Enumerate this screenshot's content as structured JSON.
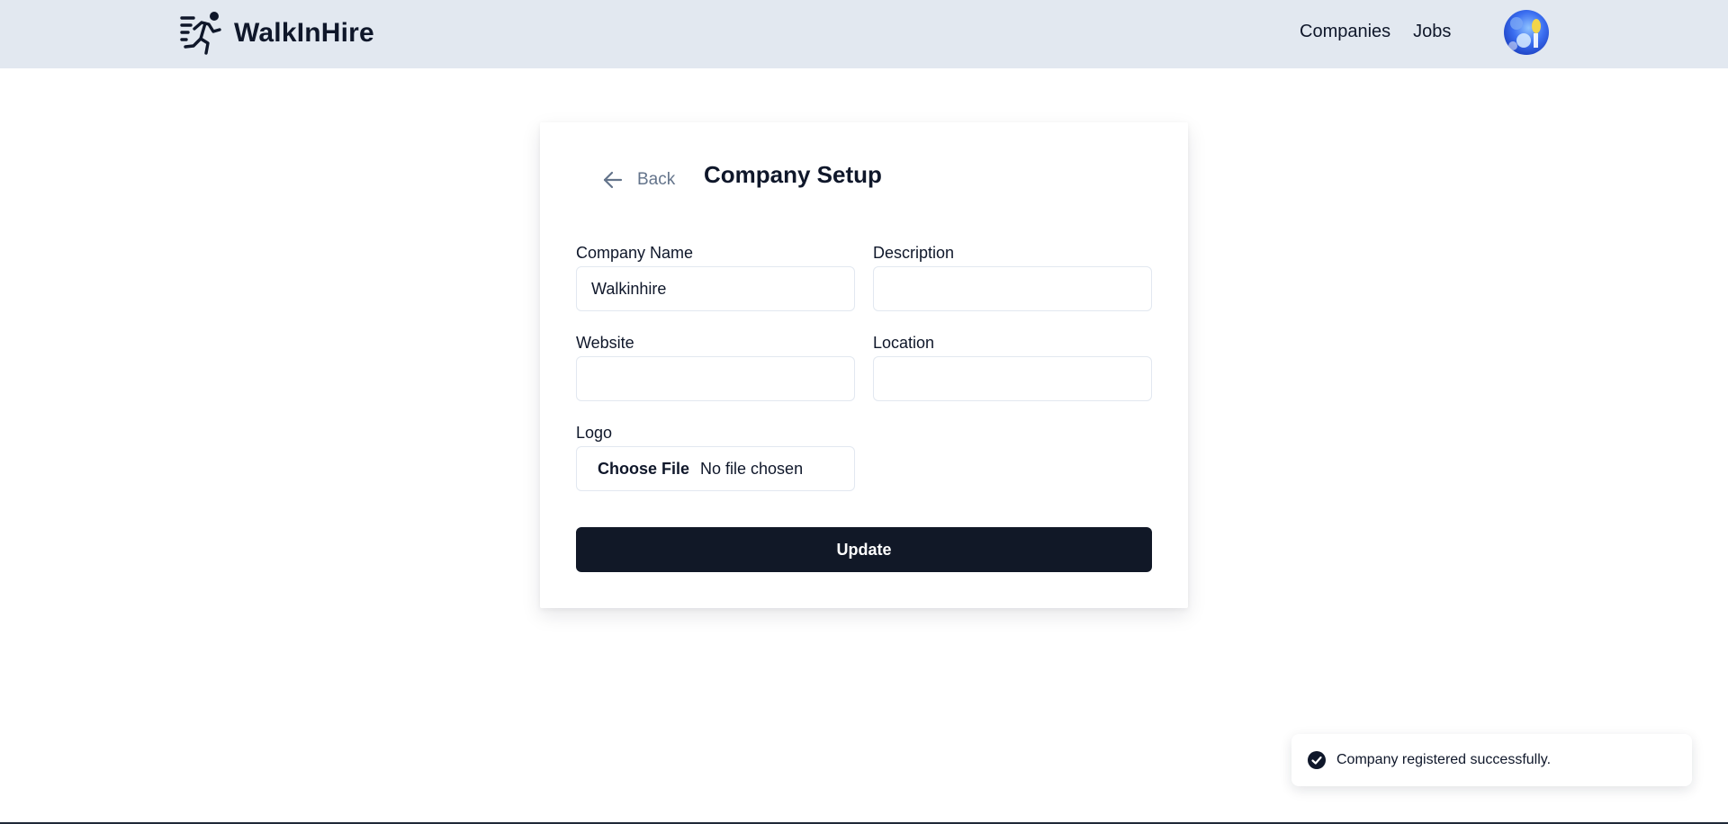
{
  "brand": {
    "name": "WalkInHire"
  },
  "nav": {
    "links": [
      "Companies",
      "Jobs"
    ]
  },
  "header": {
    "avatar_icon": "user-avatar"
  },
  "card": {
    "back_label": "Back",
    "title": "Company Setup"
  },
  "form": {
    "company_name": {
      "label": "Company Name",
      "value": "Walkinhire",
      "placeholder": ""
    },
    "description": {
      "label": "Description",
      "value": "",
      "placeholder": ""
    },
    "website": {
      "label": "Website",
      "value": "",
      "placeholder": ""
    },
    "location": {
      "label": "Location",
      "value": "",
      "placeholder": ""
    },
    "logo": {
      "label": "Logo",
      "button_label": "Choose File",
      "status": "No file chosen"
    },
    "submit_label": "Update"
  },
  "toast": {
    "message": "Company registered successfully.",
    "icon": "check-circle-icon"
  },
  "colors": {
    "navbar": "#e2e8f0",
    "primary_button": "#111827",
    "text": "#0f172a",
    "muted": "#64748b"
  }
}
